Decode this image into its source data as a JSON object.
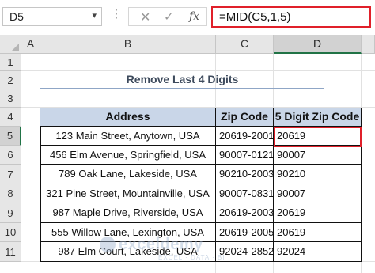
{
  "formula_bar": {
    "name_box": "D5",
    "name_box_dropdown_icon": "chevron-down-icon",
    "cancel_symbol": "✕",
    "enter_symbol": "✓",
    "fx_label": "fx",
    "formula": "=MID(C5,1,5)"
  },
  "columns": [
    "A",
    "B",
    "C",
    "D"
  ],
  "rows": [
    "1",
    "2",
    "3",
    "4",
    "5",
    "6",
    "7",
    "8",
    "9",
    "10",
    "11"
  ],
  "sheet": {
    "title": "Remove Last 4 Digits",
    "headers": {
      "address": "Address",
      "zip": "Zip Code",
      "five": "5 Digit Zip Code"
    },
    "records": [
      {
        "address": "123 Main Street, Anytown, USA",
        "zip": "20619-2001",
        "five": "20619"
      },
      {
        "address": "456 Elm Avenue, Springfield, USA",
        "zip": "90007-0121",
        "five": "90007"
      },
      {
        "address": "789 Oak Lane, Lakeside, USA",
        "zip": "90210-2003",
        "five": "90210"
      },
      {
        "address": "321 Pine Street, Mountainville, USA",
        "zip": "90007-0831",
        "five": "90007"
      },
      {
        "address": "987 Maple Drive, Riverside, USA",
        "zip": "20619-2003",
        "five": "20619"
      },
      {
        "address": "555 Willow Lane, Lexington, USA",
        "zip": "20619-2005",
        "five": "20619"
      },
      {
        "address": "987 Elm Court, Lakeside, USA",
        "zip": "92024-2852",
        "five": "92024"
      }
    ]
  },
  "colors": {
    "accent_red": "#e0202a",
    "header_fill": "#c9d6e8",
    "title_text": "#3d4a5c",
    "excel_green": "#217346"
  },
  "watermark": {
    "brand": "exceldemy",
    "tagline": "EXCEL · DATA · BI"
  }
}
